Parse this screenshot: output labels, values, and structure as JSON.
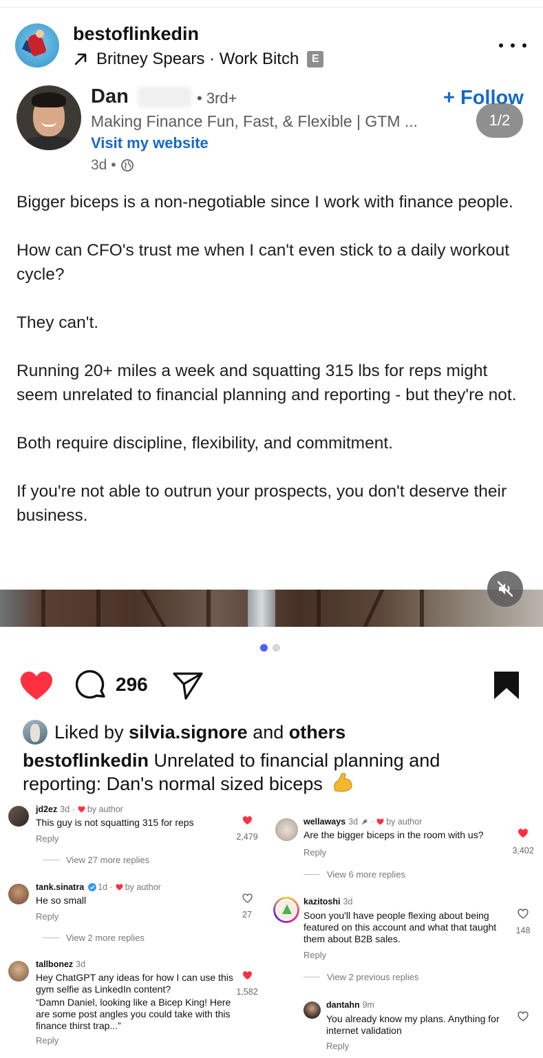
{
  "header": {
    "account": "bestoflinkedin",
    "audio": "Britney Spears · Work Bitch",
    "explicit_badge": "E",
    "more_icon": "more-horizontal-icon"
  },
  "linkedin_post": {
    "author_first_name": "Dan",
    "degree": "• 3rd+",
    "headline": "Making Finance Fun, Fast, & Flexible | GTM ...",
    "website_link": "Visit my website",
    "time": "3d •",
    "follow": "+ Follow",
    "slide_counter": "1/2",
    "paragraphs": [
      "Bigger biceps is a non-negotiable since I work with finance people.",
      "How can CFO's trust me when I can't even stick to a daily workout cycle?",
      "They can't.",
      "Running 20+ miles a week and squatting 315 lbs for reps might seem unrelated to financial planning and reporting - but they're not.",
      "Both require discipline, flexibility, and commitment.",
      "If you're not able to outrun your prospects, you don't deserve their business."
    ]
  },
  "carousel": {
    "active_index": 0,
    "count": 2
  },
  "actions": {
    "comment_count": "296",
    "liked": true,
    "saved": true
  },
  "likes": {
    "prefix": "Liked by",
    "user": "silvia.signore",
    "and": "and",
    "others": "others"
  },
  "caption": {
    "user": "bestoflinkedin",
    "text": "Unrelated to financial planning and reporting: Dan's normal sized biceps"
  },
  "colors": {
    "like_red": "#ff3040",
    "link_blue": "#1769c4",
    "dot_active": "#4a62f0"
  },
  "comments_left": [
    {
      "user": "jd2ez",
      "time": "3d ·",
      "author_like": "by author",
      "text": "This guy is not squatting 315 for reps",
      "reply": "Reply",
      "likes": "2,479",
      "liked": true,
      "view_more": "View 27 more replies"
    },
    {
      "user": "tank.sinatra",
      "time": "1d ·",
      "author_like": "by author",
      "text": "He so small",
      "reply": "Reply",
      "likes": "27",
      "liked": false,
      "view_more": "View 2 more replies"
    },
    {
      "user": "tallbonez",
      "time": "3d",
      "text": "Hey ChatGPT any ideas for how I can use this gym selfie as LinkedIn content?",
      "text2": "“Damn Daniel, looking like a Bicep King! Here are some post angles you could take with this finance thirst trap...”",
      "reply": "Reply",
      "likes": "1,582",
      "liked": true
    }
  ],
  "comments_right": [
    {
      "user": "wellaways",
      "time": "3d",
      "author_like": "by author",
      "text": "Are the bigger biceps in the room with us?",
      "reply": "Reply",
      "likes": "3,402",
      "liked": true,
      "view_more": "View 6 more replies"
    },
    {
      "user": "kazitoshi",
      "time": "3d",
      "text": "Soon you'll have people flexing about being featured on this account and what that taught them about B2B sales.",
      "reply": "Reply",
      "likes": "148",
      "liked": false,
      "view_more": "View 2 previous replies"
    },
    {
      "user": "dantahn",
      "time": "9m",
      "text": "You already know my plans. Anything for internet validation",
      "reply": "Reply",
      "liked": false
    }
  ]
}
